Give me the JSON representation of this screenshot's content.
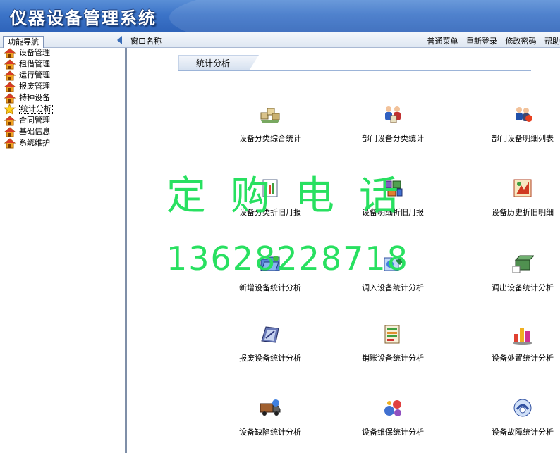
{
  "app": {
    "title": "仪器设备管理系统"
  },
  "toolbar": {
    "nav_tab": "功能导航",
    "window_name": "窗口名称",
    "links": [
      "普通菜单",
      "重新登录",
      "修改密码",
      "帮助"
    ]
  },
  "sidebar": {
    "items": [
      {
        "label": "设备管理",
        "icon": "home-icon"
      },
      {
        "label": "租借管理",
        "icon": "home-icon"
      },
      {
        "label": "运行管理",
        "icon": "home-icon"
      },
      {
        "label": "报废管理",
        "icon": "home-icon"
      },
      {
        "label": "特种设备",
        "icon": "home-icon"
      },
      {
        "label": "统计分析",
        "icon": "star-icon",
        "active": true
      },
      {
        "label": "合同管理",
        "icon": "home-icon"
      },
      {
        "label": "基础信息",
        "icon": "home-icon"
      },
      {
        "label": "系统维护",
        "icon": "home-icon"
      }
    ]
  },
  "main": {
    "section_title": "统计分析",
    "tiles": [
      {
        "label": "设备分类综合统计",
        "icon": "boxes-icon"
      },
      {
        "label": "部门设备分类统计",
        "icon": "team-icon"
      },
      {
        "label": "部门设备明细列表",
        "icon": "people-icon"
      },
      {
        "label": "设备分类折旧月报",
        "icon": "report-icon"
      },
      {
        "label": "设备明细折旧月报",
        "icon": "cubes-icon"
      },
      {
        "label": "设备历史折旧明细",
        "icon": "history-icon"
      },
      {
        "label": "新增设备统计分析",
        "icon": "new-folder-icon"
      },
      {
        "label": "调入设备统计分析",
        "icon": "import-icon"
      },
      {
        "label": "调出设备统计分析",
        "icon": "export-box-icon"
      },
      {
        "label": "报废设备统计分析",
        "icon": "scrap-icon"
      },
      {
        "label": "销账设备统计分析",
        "icon": "ledger-icon"
      },
      {
        "label": "设备处置统计分析",
        "icon": "chart-icon"
      },
      {
        "label": "设备缺陷统计分析",
        "icon": "truck-icon"
      },
      {
        "label": "设备维保统计分析",
        "icon": "maintenance-icon"
      },
      {
        "label": "设备故障统计分析",
        "icon": "fault-icon"
      }
    ]
  },
  "watermark": {
    "line1": "定购电话",
    "line2": "13628228718"
  },
  "colors": {
    "header": "#3c74c8",
    "watermark": "#28e060",
    "section_line": "#9cb4d8"
  }
}
